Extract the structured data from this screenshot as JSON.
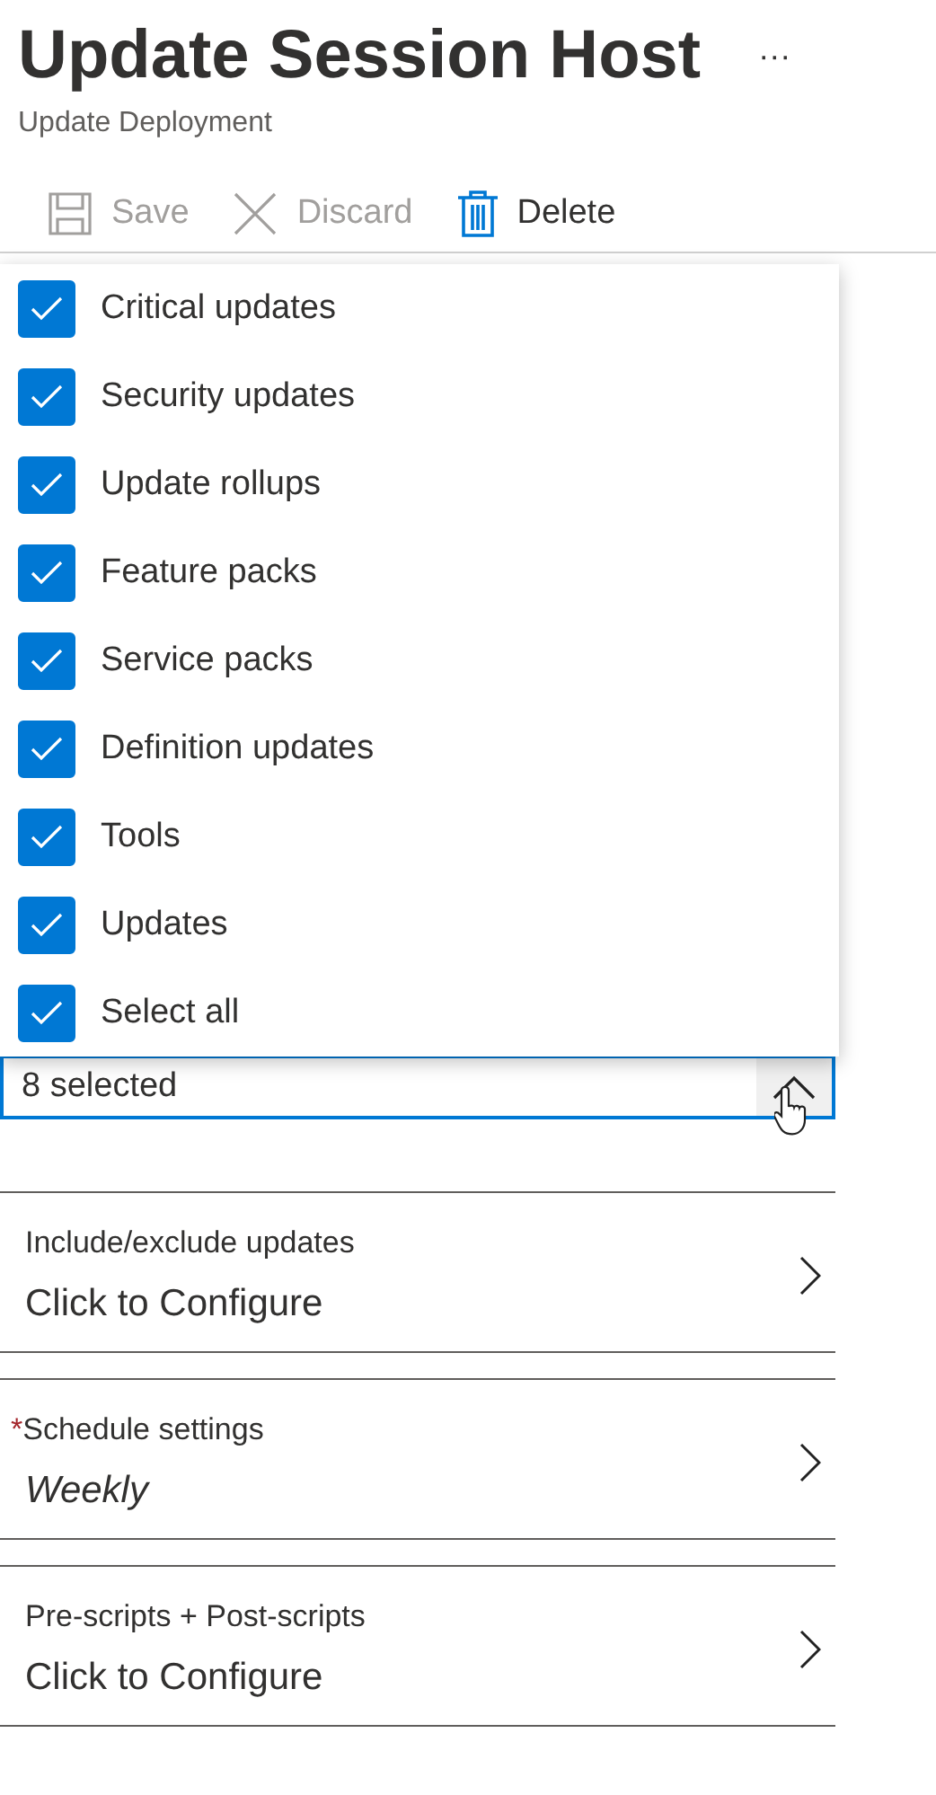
{
  "header": {
    "title": "Update Session Host",
    "more": "···",
    "subtitle": "Update Deployment"
  },
  "toolbar": [
    {
      "label": "Save",
      "kind": "save",
      "disabled": true
    },
    {
      "label": "Discard",
      "kind": "discard",
      "disabled": true
    },
    {
      "label": "Delete",
      "kind": "delete",
      "disabled": false
    }
  ],
  "dropdown": {
    "expanded": true,
    "value": "8 selected",
    "options": [
      {
        "label": "Critical updates",
        "checked": true
      },
      {
        "label": "Security updates",
        "checked": true
      },
      {
        "label": "Update rollups",
        "checked": true
      },
      {
        "label": "Feature packs",
        "checked": true
      },
      {
        "label": "Service packs",
        "checked": true
      },
      {
        "label": "Definition updates",
        "checked": true
      },
      {
        "label": "Tools",
        "checked": true
      },
      {
        "label": "Updates",
        "checked": true
      },
      {
        "label": "Select all",
        "checked": true
      }
    ]
  },
  "sections": [
    {
      "label": "Include/exclude updates",
      "required": false,
      "value": "Click to Configure",
      "italic": false
    },
    {
      "label": "Schedule settings",
      "required": true,
      "required_mark": "*",
      "value": "Weekly",
      "italic": true
    },
    {
      "label": "Pre-scripts + Post-scripts",
      "required": false,
      "value": "Click to Configure",
      "italic": false
    }
  ]
}
